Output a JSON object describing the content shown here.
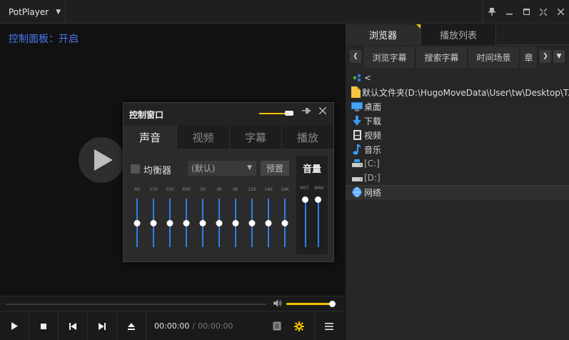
{
  "app": {
    "name": "PotPlayer"
  },
  "osd": {
    "text": "控制面板：开启"
  },
  "playback": {
    "current_time": "00:00:00",
    "total_time": "00:00:00",
    "time_separator": "/",
    "volume_fraction": 1.0
  },
  "panel": {
    "tabs": [
      {
        "label": "浏览器"
      },
      {
        "label": "播放列表"
      }
    ],
    "subtabs": [
      {
        "label": "浏览字幕"
      },
      {
        "label": "搜索字幕"
      },
      {
        "label": "时间场景"
      },
      {
        "label": "章"
      }
    ],
    "tree": [
      {
        "label": "<",
        "icon": "network-up-icon"
      },
      {
        "label": "默认文件夹(D:\\HugoMoveData\\User\\tw\\Desktop\\T...",
        "icon": "folder-icon"
      },
      {
        "label": "桌面",
        "icon": "desktop-icon"
      },
      {
        "label": "下载",
        "icon": "download-icon"
      },
      {
        "label": "视频",
        "icon": "video-icon"
      },
      {
        "label": "音乐",
        "icon": "music-icon"
      },
      {
        "label": "[C:]",
        "icon": "drive-icon"
      },
      {
        "label": "[D:]",
        "icon": "drive-icon"
      },
      {
        "label": "网络",
        "icon": "network-icon"
      }
    ]
  },
  "control_window": {
    "title": "控制窗口",
    "tabs": [
      {
        "label": "声音"
      },
      {
        "label": "视频"
      },
      {
        "label": "字幕"
      },
      {
        "label": "播放"
      }
    ],
    "equalizer": {
      "label": "均衡器",
      "preset_value": "(默认)",
      "preset_button": "预置",
      "bands": [
        {
          "label": "60",
          "level": 0.5
        },
        {
          "label": "170",
          "level": 0.5
        },
        {
          "label": "310",
          "level": 0.5
        },
        {
          "label": "600",
          "level": 0.5
        },
        {
          "label": "1K",
          "level": 0.5
        },
        {
          "label": "3K",
          "level": 0.5
        },
        {
          "label": "6K",
          "level": 0.5
        },
        {
          "label": "12K",
          "level": 0.5
        },
        {
          "label": "14K",
          "level": 0.5
        },
        {
          "label": "16K",
          "level": 0.5
        }
      ]
    },
    "volume": {
      "title": "音量",
      "mst_label": "MST",
      "wav_label": "WAV",
      "mst_level": 1.0,
      "wav_level": 1.0
    }
  },
  "colors": {
    "accent": "#f3c200",
    "osd": "#4a78f0",
    "eq_track": "#2f7fe8"
  }
}
